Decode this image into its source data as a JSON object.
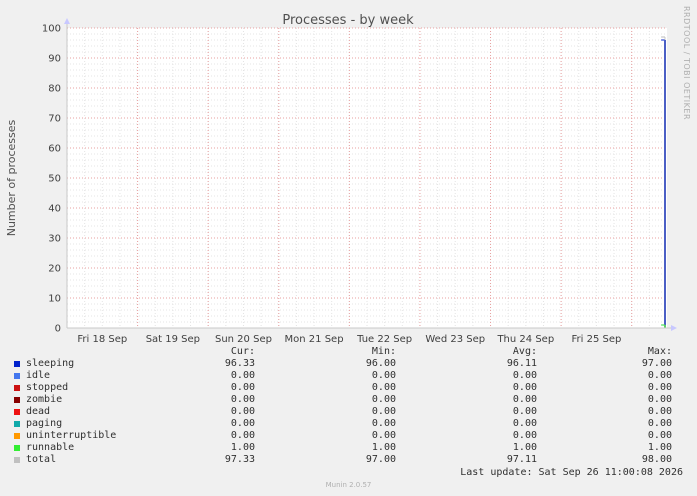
{
  "chart_data": {
    "type": "line",
    "title": "Processes - by week",
    "ylabel": "Number of processes",
    "side_label": "RRDTOOL / TOBI OETIKER",
    "ylim": [
      0,
      100
    ],
    "yticks": [
      0,
      10,
      20,
      30,
      40,
      50,
      60,
      70,
      80,
      90,
      100
    ],
    "xlim": [
      "2026-09-18T00:00",
      "2026-09-26T12:00"
    ],
    "xticks": [
      {
        "label": "Fri 18 Sep",
        "x": "2026-09-18T12:00"
      },
      {
        "label": "Sat 19 Sep",
        "x": "2026-09-19T12:00"
      },
      {
        "label": "Sun 20 Sep",
        "x": "2026-09-20T12:00"
      },
      {
        "label": "Mon 21 Sep",
        "x": "2026-09-21T12:00"
      },
      {
        "label": "Tue 22 Sep",
        "x": "2026-09-22T12:00"
      },
      {
        "label": "Wed 23 Sep",
        "x": "2026-09-23T12:00"
      },
      {
        "label": "Thu 24 Sep",
        "x": "2026-09-24T12:00"
      },
      {
        "label": "Fri 25 Sep",
        "x": "2026-09-25T12:00"
      }
    ],
    "midnights": [
      "2026-09-19T00:00",
      "2026-09-20T00:00",
      "2026-09-21T00:00",
      "2026-09-22T00:00",
      "2026-09-23T00:00",
      "2026-09-24T00:00",
      "2026-09-25T00:00",
      "2026-09-26T00:00"
    ],
    "data_start": "2026-09-26T10:00",
    "series": [
      {
        "name": "sleeping",
        "color": "#0022cc",
        "value": 96
      },
      {
        "name": "runnable",
        "color": "#22dd33",
        "value": 1
      },
      {
        "name": "total",
        "color": "#bbbbbb",
        "value": 97
      }
    ]
  },
  "legend": {
    "headers": {
      "cur": "Cur:",
      "min": "Min:",
      "avg": "Avg:",
      "max": "Max:"
    },
    "rows": [
      {
        "name": "sleeping",
        "color": "#0022cc",
        "cur": "96.33",
        "min": "96.00",
        "avg": "96.11",
        "max": "97.00"
      },
      {
        "name": "idle",
        "color": "#4477ee",
        "cur": "0.00",
        "min": "0.00",
        "avg": "0.00",
        "max": "0.00"
      },
      {
        "name": "stopped",
        "color": "#cc1111",
        "cur": "0.00",
        "min": "0.00",
        "avg": "0.00",
        "max": "0.00"
      },
      {
        "name": "zombie",
        "color": "#880000",
        "cur": "0.00",
        "min": "0.00",
        "avg": "0.00",
        "max": "0.00"
      },
      {
        "name": "dead",
        "color": "#ee1111",
        "cur": "0.00",
        "min": "0.00",
        "avg": "0.00",
        "max": "0.00"
      },
      {
        "name": "paging",
        "color": "#11aaaa",
        "cur": "0.00",
        "min": "0.00",
        "avg": "0.00",
        "max": "0.00"
      },
      {
        "name": "uninterruptible",
        "color": "#ff9900",
        "cur": "0.00",
        "min": "0.00",
        "avg": "0.00",
        "max": "0.00"
      },
      {
        "name": "runnable",
        "color": "#33ee33",
        "cur": "1.00",
        "min": "1.00",
        "avg": "1.00",
        "max": "1.00"
      },
      {
        "name": "total",
        "color": "#c0c0c0",
        "cur": "97.33",
        "min": "97.00",
        "avg": "97.11",
        "max": "98.00"
      }
    ]
  },
  "last_update": "Last update: Sat Sep 26 11:00:08 2026",
  "footer": "Munin 2.0.57"
}
